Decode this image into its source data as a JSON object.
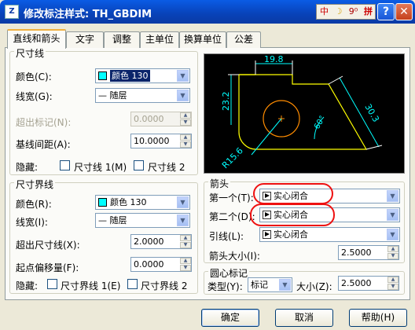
{
  "window": {
    "title": "修改标注样式: TH_GBDIM",
    "app_icon_text": "Z",
    "ime": [
      "中",
      "☽",
      "9⁰",
      "拼"
    ],
    "help_label": "?",
    "close_label": "✕"
  },
  "tabs": [
    "直线和箭头",
    "文字",
    "调整",
    "主单位",
    "换算单位",
    "公差"
  ],
  "dim_lines": {
    "group_title": "尺寸线",
    "color_label": "颜色(C):",
    "color_value": "颜色 130",
    "linewidth_label": "线宽(G):",
    "linewidth_value": "— 随层",
    "extend_label": "超出标记(N):",
    "extend_value": "0.0000",
    "baseline_label": "基线间距(A):",
    "baseline_value": "10.0000",
    "suppress_label": "隐藏:",
    "suppress_1": "尺寸线 1(M)",
    "suppress_2": "尺寸线 2"
  },
  "ext_lines": {
    "group_title": "尺寸界线",
    "color_label": "颜色(R):",
    "color_value": "颜色 130",
    "linewidth_label": "线宽(I):",
    "linewidth_value": "— 随层",
    "extend_label": "超出尺寸线(X):",
    "extend_value": "2.0000",
    "offset_label": "起点偏移量(F):",
    "offset_value": "0.0000",
    "suppress_label": "隐藏:",
    "suppress_1": "尺寸界线 1(E)",
    "suppress_2": "尺寸界线 2"
  },
  "preview": {
    "dims": [
      "19.8",
      "23.2",
      "30.3",
      "60°",
      "R15.6"
    ],
    "colors": {
      "dim": "#00ffff",
      "geom": "#ffff00",
      "arc": "#ff8c00",
      "ext": "#ffffff"
    }
  },
  "arrows": {
    "group_title": "箭头",
    "first_label": "第一个(T):",
    "first_value": "实心闭合",
    "second_label": "第二个(D):",
    "second_value": "实心闭合",
    "leader_label": "引线(L):",
    "leader_value": "实心闭合",
    "size_label": "箭头大小(I):",
    "size_value": "2.5000"
  },
  "center_mark": {
    "group_title": "圆心标记",
    "type_label": "类型(Y):",
    "type_value": "标记",
    "size_label": "大小(Z):",
    "size_value": "2.5000"
  },
  "buttons": {
    "ok": "确定",
    "cancel": "取消",
    "help": "帮助(H)"
  }
}
